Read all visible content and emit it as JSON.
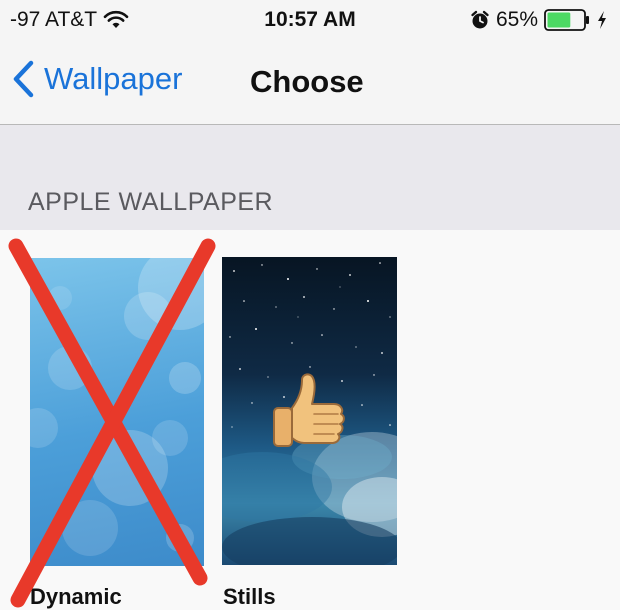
{
  "status_bar": {
    "carrier": "-97 AT&T",
    "time": "10:57 AM",
    "battery_percent": "65%",
    "battery_level": 0.65,
    "icons": [
      "wifi-icon",
      "alarm-icon",
      "battery-icon",
      "charging-bolt-icon"
    ]
  },
  "nav": {
    "back_label": "Wallpaper",
    "title": "Choose"
  },
  "section": {
    "title": "APPLE WALLPAPER"
  },
  "wallpapers": [
    {
      "label": "Dynamic",
      "annotation": "red-x-mark"
    },
    {
      "label": "Stills",
      "annotation": "thumbs-up-emoji"
    }
  ],
  "colors": {
    "accent": "#1a73d9",
    "battery_fill": "#4cd964",
    "section_bg": "#e9e8ed",
    "red_x": "#e8392a"
  }
}
